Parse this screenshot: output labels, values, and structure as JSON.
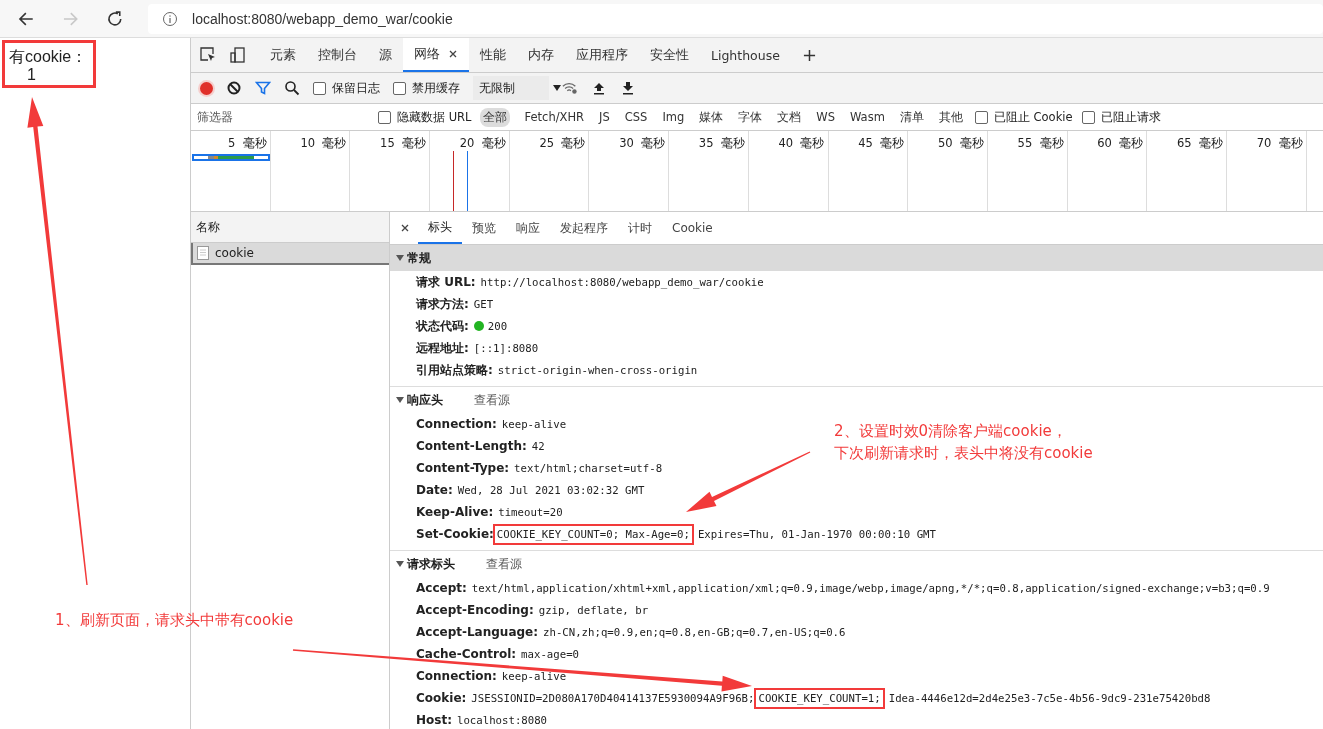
{
  "browser": {
    "url": "localhost:8080/webapp_demo_war/cookie",
    "forward_disabled": true
  },
  "page": {
    "lines": [
      "有cookie：",
      "1"
    ],
    "highlighted": true
  },
  "devtools": {
    "tabs": [
      {
        "label": "元素",
        "selected": false
      },
      {
        "label": "控制台",
        "selected": false
      },
      {
        "label": "源",
        "selected": false
      },
      {
        "label": "网络",
        "selected": true
      },
      {
        "label": "性能",
        "selected": false
      },
      {
        "label": "内存",
        "selected": false
      },
      {
        "label": "应用程序",
        "selected": false
      },
      {
        "label": "安全性",
        "selected": false
      },
      {
        "label": "Lighthouse",
        "selected": false
      }
    ],
    "toolbar": {
      "recording": true,
      "checkboxes": [
        {
          "label": "保留日志",
          "checked": false
        },
        {
          "label": "禁用缓存",
          "checked": false
        }
      ],
      "throttle": "无限制"
    },
    "filter": {
      "placeholder": "筛选器",
      "hide_data": {
        "label": "隐藏数据 URL",
        "checked": false
      },
      "types": [
        {
          "label": "全部",
          "selected": true
        },
        {
          "label": "Fetch/XHR",
          "selected": false
        },
        {
          "label": "JS",
          "selected": false
        },
        {
          "label": "CSS",
          "selected": false
        },
        {
          "label": "Img",
          "selected": false
        },
        {
          "label": "媒体",
          "selected": false
        },
        {
          "label": "字体",
          "selected": false
        },
        {
          "label": "文档",
          "selected": false
        },
        {
          "label": "WS",
          "selected": false
        },
        {
          "label": "Wasm",
          "selected": false
        },
        {
          "label": "清单",
          "selected": false
        },
        {
          "label": "其他",
          "selected": false
        }
      ],
      "blocked": [
        {
          "label": "已阻止 Cookie",
          "checked": false
        },
        {
          "label": "已阻止请求",
          "checked": false
        }
      ]
    },
    "timeline": {
      "ticks": [
        "5  毫秒",
        "10  毫秒",
        "15  毫秒",
        "20  毫秒",
        "25  毫秒",
        "30  毫秒",
        "35  毫秒",
        "40  毫秒",
        "45  毫秒",
        "50  毫秒",
        "55  毫秒",
        "60  毫秒",
        "65  毫秒",
        "70  毫秒"
      ]
    },
    "requests": {
      "header": "名称",
      "rows": [
        {
          "name": "cookie",
          "selected": true
        }
      ]
    },
    "detail": {
      "tabs": [
        {
          "label": "标头",
          "selected": true
        },
        {
          "label": "预览",
          "selected": false
        },
        {
          "label": "响应",
          "selected": false
        },
        {
          "label": "发起程序",
          "selected": false
        },
        {
          "label": "计时",
          "selected": false
        },
        {
          "label": "Cookie",
          "selected": false
        }
      ],
      "sections": [
        {
          "title": "常规",
          "expanded": true,
          "focused": true,
          "rows": [
            {
              "kind": "text",
              "label": "请求 URL:",
              "value": [
                {
                  "text": "http://localhost:8080/webapp_demo_war/cookie",
                  "highlighted": false
                }
              ]
            },
            {
              "kind": "text",
              "label": "请求方法:",
              "value": [
                {
                  "text": "GET",
                  "highlighted": false
                }
              ]
            },
            {
              "kind": "status",
              "label": "状态代码:",
              "value": [
                {
                  "text": "200",
                  "highlighted": false
                }
              ]
            },
            {
              "kind": "text",
              "label": "远程地址:",
              "value": [
                {
                  "text": "[::1]:8080",
                  "highlighted": false
                }
              ]
            },
            {
              "kind": "text",
              "label": "引用站点策略:",
              "value": [
                {
                  "text": "strict-origin-when-cross-origin",
                  "highlighted": false
                }
              ]
            }
          ]
        },
        {
          "title": "响应头",
          "view_source": "查看源",
          "expanded": true,
          "focused": false,
          "rows": [
            {
              "kind": "text",
              "label": "Connection:",
              "value": [
                {
                  "text": "keep-alive",
                  "highlighted": false
                }
              ]
            },
            {
              "kind": "text",
              "label": "Content-Length:",
              "value": [
                {
                  "text": "42",
                  "highlighted": false
                }
              ]
            },
            {
              "kind": "text",
              "label": "Content-Type:",
              "value": [
                {
                  "text": "text/html;charset=utf-8",
                  "highlighted": false
                }
              ]
            },
            {
              "kind": "text",
              "label": "Date:",
              "value": [
                {
                  "text": "Wed, 28 Jul 2021 03:02:32 GMT",
                  "highlighted": false
                }
              ]
            },
            {
              "kind": "text",
              "label": "Keep-Alive:",
              "value": [
                {
                  "text": "timeout=20",
                  "highlighted": false
                }
              ]
            },
            {
              "kind": "text",
              "label": "Set-Cookie:",
              "value": [
                {
                  "text": "COOKIE_KEY_COUNT=0; Max-Age=0;",
                  "highlighted": true
                },
                {
                  "text": "Expires=Thu, 01-Jan-1970 00:00:10 GMT",
                  "highlighted": false
                }
              ]
            }
          ]
        },
        {
          "title": "请求标头",
          "view_source": "查看源",
          "expanded": true,
          "focused": false,
          "rows": [
            {
              "kind": "text",
              "label": "Accept:",
              "value": [
                {
                  "text": "text/html,application/xhtml+xml,application/xml;q=0.9,image/webp,image/apng,*/*;q=0.8,application/signed-exchange;v=b3;q=0.9",
                  "highlighted": false
                }
              ]
            },
            {
              "kind": "text",
              "label": "Accept-Encoding:",
              "value": [
                {
                  "text": "gzip, deflate, br",
                  "highlighted": false
                }
              ]
            },
            {
              "kind": "text",
              "label": "Accept-Language:",
              "value": [
                {
                  "text": "zh-CN,zh;q=0.9,en;q=0.8,en-GB;q=0.7,en-US;q=0.6",
                  "highlighted": false
                }
              ]
            },
            {
              "kind": "text",
              "label": "Cache-Control:",
              "value": [
                {
                  "text": "max-age=0",
                  "highlighted": false
                }
              ]
            },
            {
              "kind": "text",
              "label": "Connection:",
              "value": [
                {
                  "text": "keep-alive",
                  "highlighted": false
                }
              ]
            },
            {
              "kind": "text",
              "label": "Cookie:",
              "value": [
                {
                  "text": "JSESSIONID=2D080A170D40414137E5930094A9F96B;",
                  "highlighted": false
                },
                {
                  "text": "COOKIE_KEY_COUNT=1;",
                  "highlighted": true
                },
                {
                  "text": "Idea-4446e12d=2d4e25e3-7c5e-4b56-9dc9-231e75420bd8",
                  "highlighted": false
                }
              ]
            },
            {
              "kind": "text",
              "label": "Host:",
              "value": [
                {
                  "text": "localhost:8080",
                  "highlighted": false
                }
              ]
            }
          ]
        }
      ]
    }
  },
  "annotations": [
    {
      "lines": [
        "1、刷新页面，请求头中带有cookie"
      ]
    },
    {
      "lines": [
        "2、设置时效0清除客户端cookie，",
        "下次刷新请求时，表头中将没有cookie"
      ]
    }
  ]
}
